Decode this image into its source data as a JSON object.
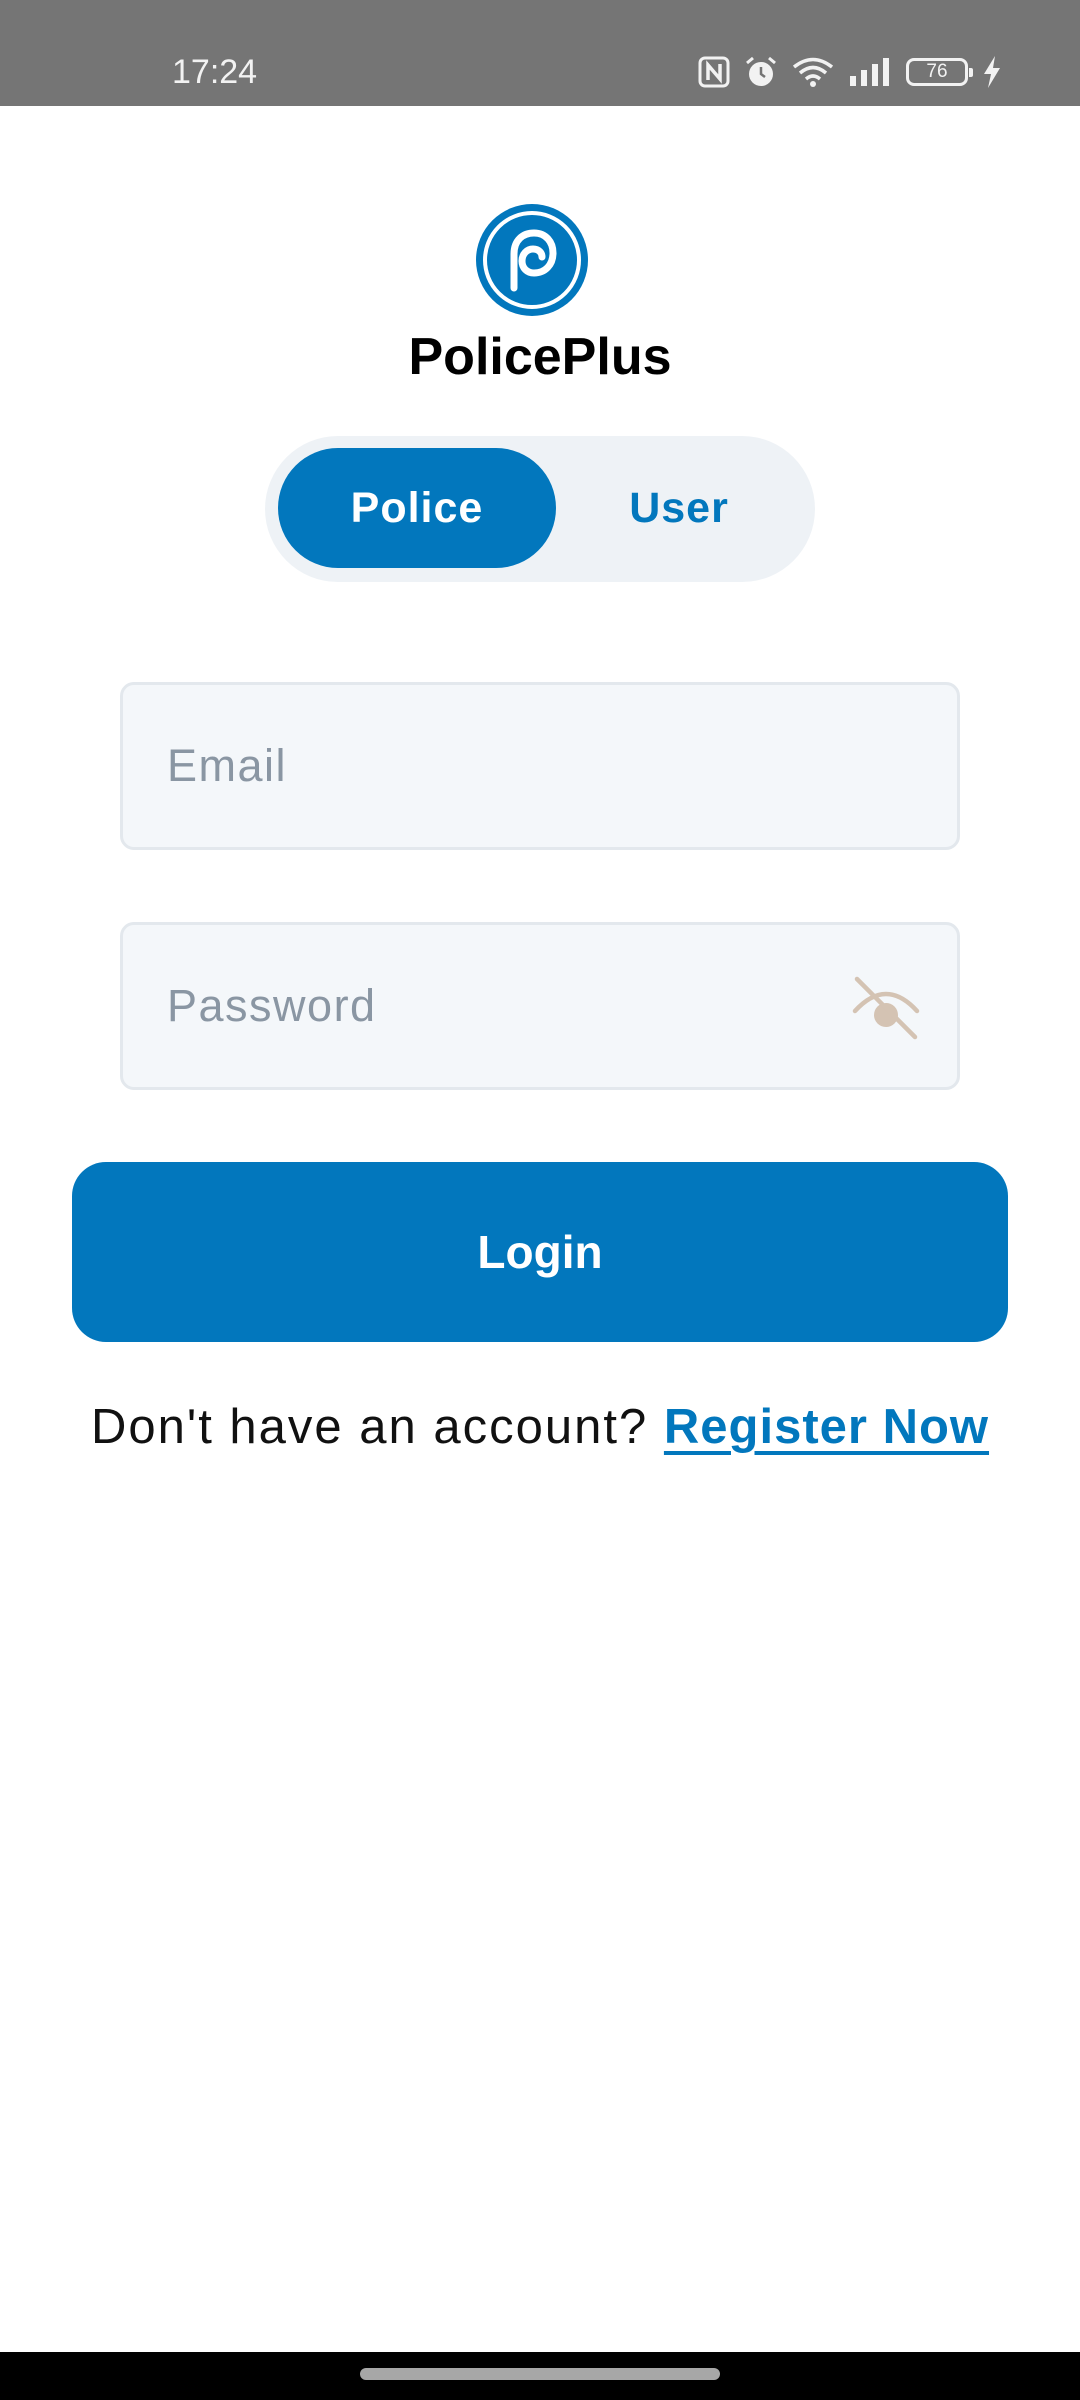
{
  "status_bar": {
    "time": "17:24",
    "battery_level": "76",
    "icons": [
      "nfc-icon",
      "alarm-icon",
      "wifi-icon",
      "signal-icon",
      "battery-icon",
      "charging-icon"
    ]
  },
  "app": {
    "title": "PolicePlus",
    "logo_icon": "policeplus-logo-icon",
    "brand_color": "#0277bd"
  },
  "role_toggle": {
    "options": [
      {
        "label": "Police",
        "selected": true
      },
      {
        "label": "User",
        "selected": false
      }
    ]
  },
  "form": {
    "email": {
      "placeholder": "Email",
      "value": ""
    },
    "password": {
      "placeholder": "Password",
      "value": "",
      "visibility_icon": "eye-off-icon"
    },
    "login_label": "Login"
  },
  "register": {
    "prompt": "Don't have an account? ",
    "link_label": "Register Now"
  }
}
